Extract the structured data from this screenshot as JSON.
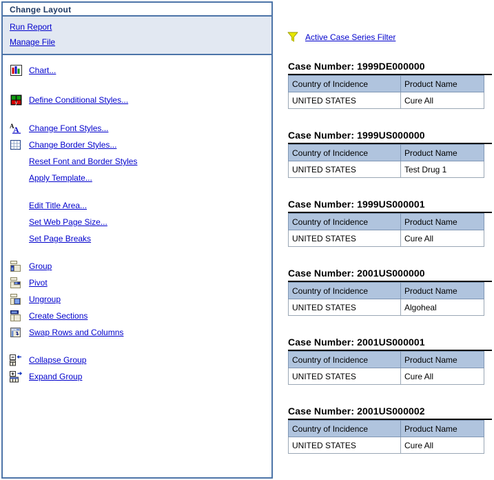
{
  "panel": {
    "title": "Change Layout",
    "quick_links": [
      {
        "label": "Run Report",
        "name": "run-report"
      },
      {
        "label": "Manage File",
        "name": "manage-file"
      }
    ],
    "groups": [
      {
        "items": [
          {
            "label": "Chart...",
            "icon": "chart-icon",
            "name": "chart"
          }
        ]
      },
      {
        "items": [
          {
            "label": "Define Conditional Styles...",
            "icon": "conditional-styles-icon",
            "name": "define-conditional-styles"
          }
        ]
      },
      {
        "items": [
          {
            "label": "Change Font Styles...",
            "icon": "font-styles-icon",
            "name": "change-font-styles"
          },
          {
            "label": "Change Border Styles...",
            "icon": "border-styles-icon",
            "name": "change-border-styles"
          },
          {
            "label": "Reset Font and Border Styles",
            "icon": "",
            "name": "reset-font-and-border-styles"
          },
          {
            "label": "Apply Template...",
            "icon": "",
            "name": "apply-template"
          }
        ]
      },
      {
        "items": [
          {
            "label": "Edit Title Area...",
            "icon": "",
            "name": "edit-title-area"
          },
          {
            "label": "Set Web Page Size...",
            "icon": "",
            "name": "set-web-page-size"
          },
          {
            "label": "Set Page Breaks",
            "icon": "",
            "name": "set-page-breaks"
          }
        ]
      },
      {
        "items": [
          {
            "label": "Group",
            "icon": "group-icon",
            "name": "group"
          },
          {
            "label": "Pivot",
            "icon": "pivot-icon",
            "name": "pivot"
          },
          {
            "label": "Ungroup",
            "icon": "ungroup-icon",
            "name": "ungroup"
          },
          {
            "label": "Create Sections",
            "icon": "create-sections-icon",
            "name": "create-sections"
          },
          {
            "label": "Swap Rows and Columns",
            "icon": "swap-rows-columns-icon",
            "name": "swap-rows-and-columns"
          }
        ]
      },
      {
        "items": [
          {
            "label": "Collapse Group",
            "icon": "collapse-group-icon",
            "name": "collapse-group"
          },
          {
            "label": "Expand Group",
            "icon": "expand-group-icon",
            "name": "expand-group"
          }
        ]
      }
    ]
  },
  "report": {
    "filter": {
      "icon": "funnel-filter-icon",
      "label": "Active Case Series Filter"
    },
    "case_label_prefix": "Case Number: ",
    "columns": [
      "Country of Incidence",
      "Product Name"
    ],
    "cases": [
      {
        "case_number": "1999DE000000",
        "title": "Case Number: 1999DE000000",
        "country": "UNITED STATES",
        "product": "Cure All"
      },
      {
        "case_number": "1999US000000",
        "title": "Case Number: 1999US000000",
        "country": "UNITED STATES",
        "product": "Test Drug 1"
      },
      {
        "case_number": "1999US000001",
        "title": "Case Number: 1999US000001",
        "country": "UNITED STATES",
        "product": "Cure All"
      },
      {
        "case_number": "2001US000000",
        "title": "Case Number: 2001US000000",
        "country": "UNITED STATES",
        "product": "Algoheal"
      },
      {
        "case_number": "2001US000001",
        "title": "Case Number: 2001US000001",
        "country": "UNITED STATES",
        "product": "Cure All"
      },
      {
        "case_number": "2001US000002",
        "title": "Case Number: 2001US000002",
        "country": "UNITED STATES",
        "product": "Cure All"
      }
    ]
  },
  "colors": {
    "panel_border": "#4c74a8",
    "quick_links_bg": "#e2e8f2",
    "link": "#0000cc",
    "title_text": "#1f3a63",
    "table_header_bg": "#b0c4de",
    "filter_icon": "#e8e800"
  }
}
